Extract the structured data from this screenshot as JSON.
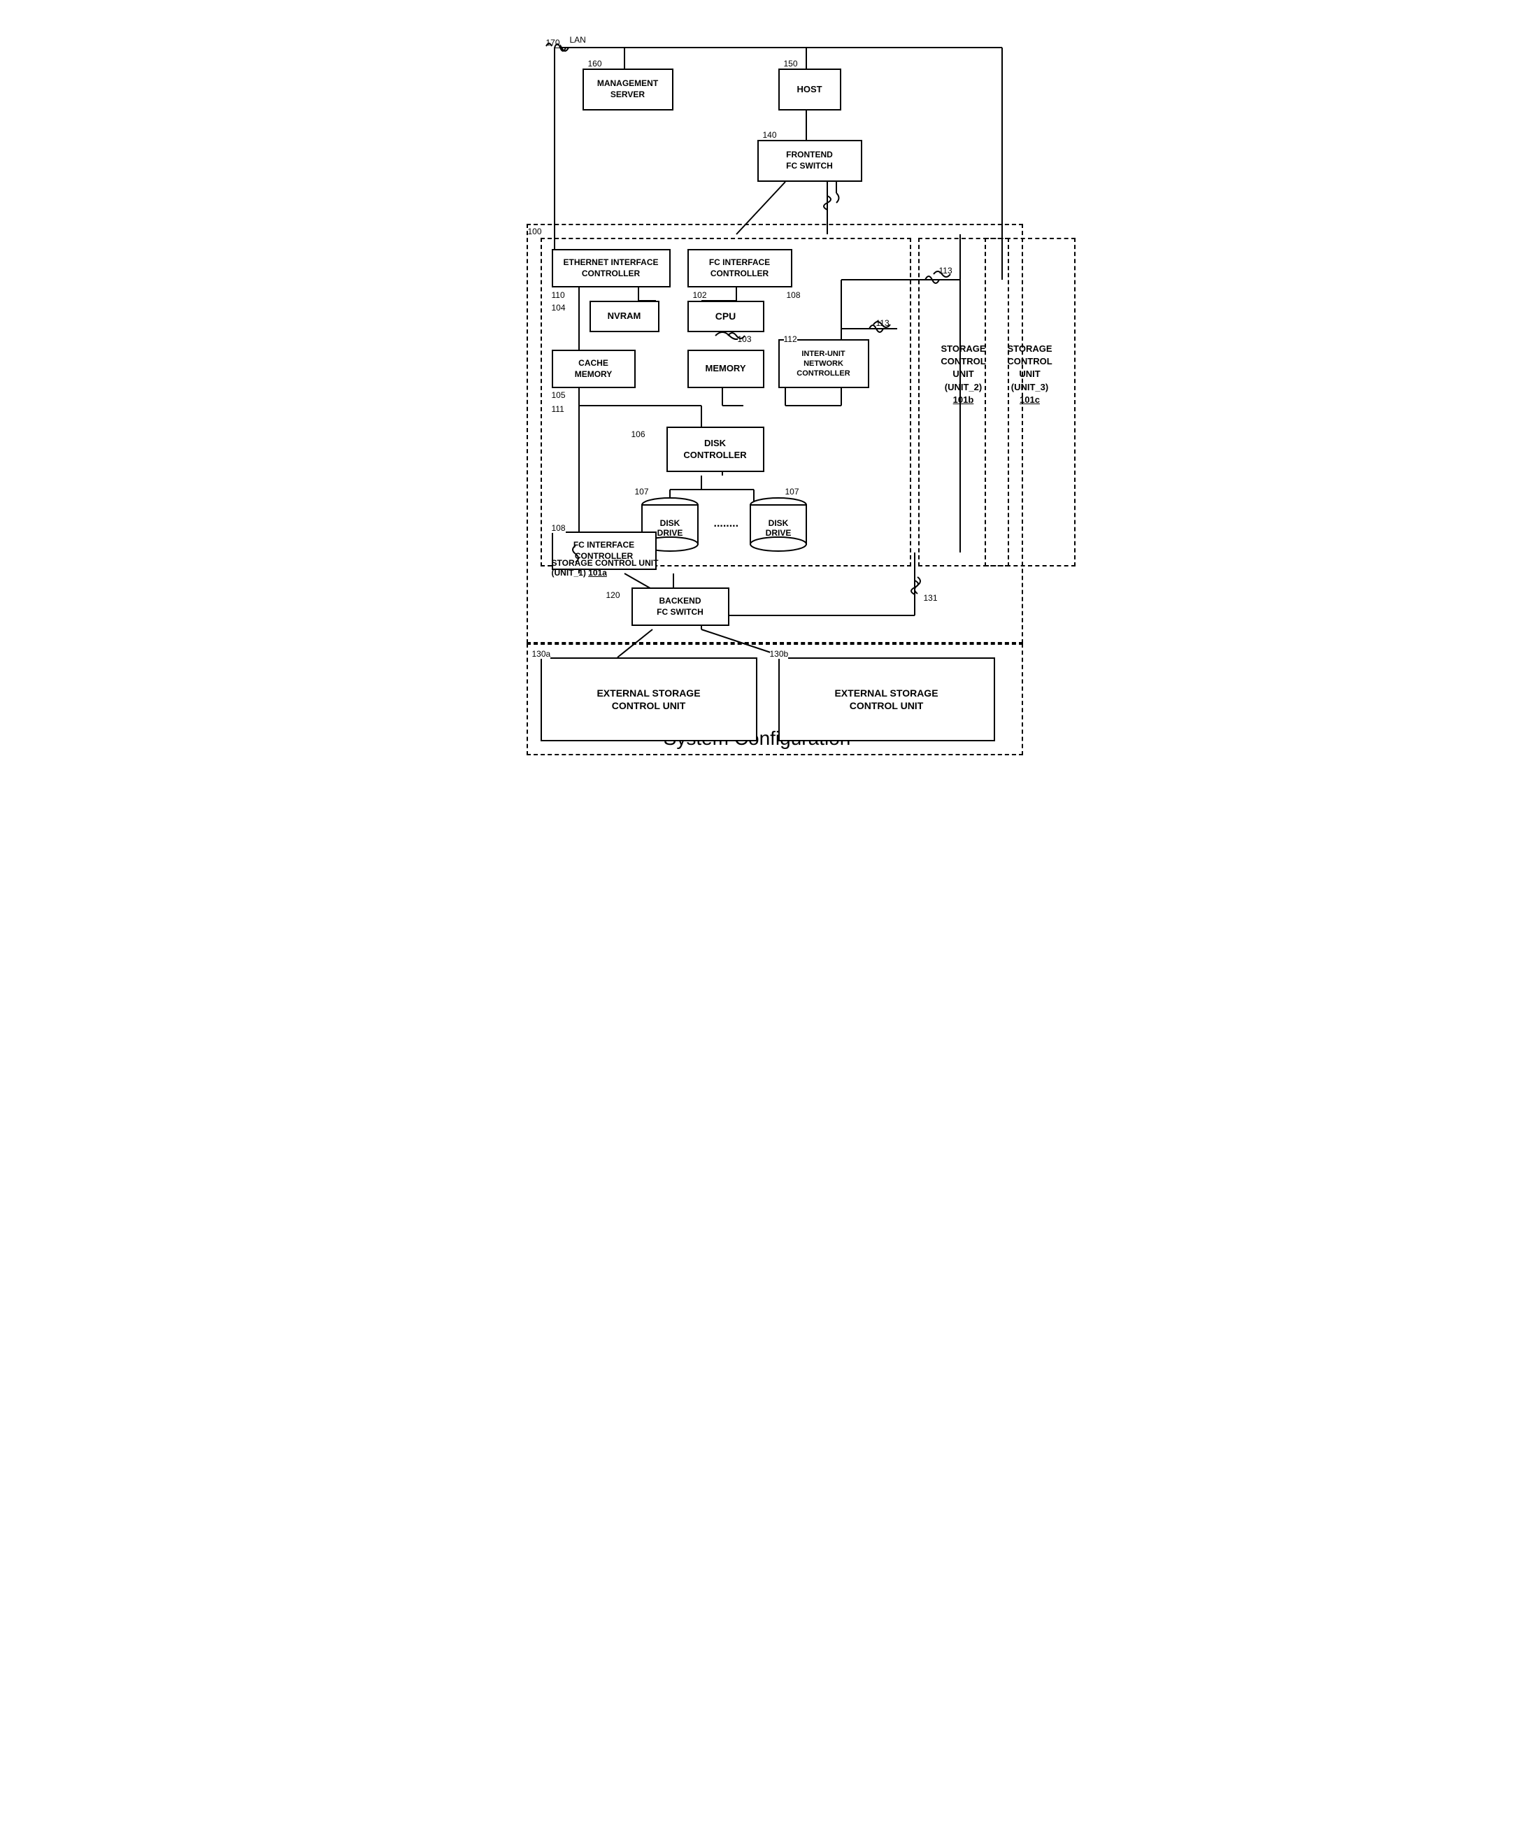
{
  "title": "System Configuration",
  "labels": {
    "lan": "LAN",
    "management_server": "MANAGEMENT\nSERVER",
    "host": "HOST",
    "frontend_fc_switch": "FRONTEND\nFC SWITCH",
    "ethernet_interface_controller": "ETHERNET INTERFACE\nCONTROLLER",
    "fc_interface_controller_top": "FC INTERFACE\nCONTROLLER",
    "nvram": "NVRAM",
    "cpu": "CPU",
    "cache_memory": "CACHE\nMEMORY",
    "memory": "MEMORY",
    "inter_unit_network_controller": "INTER-UNIT\nNETWORK\nCONTROLLER",
    "disk_controller": "DISK\nCONTROLLER",
    "disk_drive_1": "DISK\nDRIVE",
    "disk_drive_2": "DISK\nDRIVE",
    "fc_interface_controller_bottom": "FC INTERFACE\nCONTROLLER",
    "storage_control_unit_1": "STORAGE CONTROL UNIT\n(UNIT_1)",
    "storage_control_unit_1_id": "101a",
    "storage_control_unit_2": "STORAGE\nCONTROL\nUNIT\n(UNIT_2)",
    "storage_control_unit_2_id": "101b",
    "storage_control_unit_3": "STORAGE\nCONTROL\nUNIT\n(UNIT_3)",
    "storage_control_unit_3_id": "101c",
    "backend_fc_switch": "BACKEND\nFC SWITCH",
    "external_storage_1": "EXTERNAL STORAGE\nCONTROL UNIT",
    "external_storage_2": "EXTERNAL STORAGE\nCONTROL UNIT",
    "n170": "170",
    "n160": "160",
    "n150": "150",
    "n140": "140",
    "n100": "100",
    "n110": "110",
    "n104": "104",
    "n105": "105",
    "n102": "102",
    "n108_top": "108",
    "n108_bottom": "108",
    "n103": "103",
    "n112": "112",
    "n113a": "113",
    "n113b": "113",
    "n111": "111",
    "n106": "106",
    "n107a": "107",
    "n107b": "107",
    "n120": "120",
    "n130a": "130a",
    "n130b": "130b",
    "n131": "131",
    "n101a": "101a",
    "dots": "........"
  }
}
